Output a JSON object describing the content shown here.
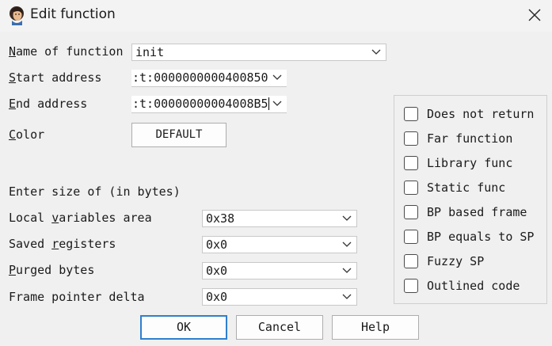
{
  "window": {
    "title": "Edit function",
    "app_icon": "ida-icon",
    "close_icon": "close-icon"
  },
  "form": {
    "name_label_prefix": "N",
    "name_label_rest": "ame of function",
    "name_value": "init",
    "start_label_prefix": "S",
    "start_label_rest": "tart address",
    "start_value": ":t:0000000000400850",
    "end_label_prefix": "E",
    "end_label_rest": "nd address",
    "end_value": ":t:00000000004008B5",
    "color_label_prefix": "C",
    "color_label_rest": "olor",
    "color_button": "DEFAULT",
    "size_heading": "Enter size of (in bytes)",
    "local_vars_label_a": "Local ",
    "local_vars_label_u": "v",
    "local_vars_label_b": "ariables area",
    "local_vars_value": "0x38",
    "saved_regs_label_a": "Saved ",
    "saved_regs_label_u": "r",
    "saved_regs_label_b": "egisters",
    "saved_regs_value": "0x0",
    "purged_label_u": "P",
    "purged_label_b": "urged bytes",
    "purged_value": "0x0",
    "frame_ptr_label": "Frame pointer delta",
    "frame_ptr_value": "0x0"
  },
  "flags": [
    {
      "label": "Does not return",
      "checked": false
    },
    {
      "label": "Far function",
      "checked": false
    },
    {
      "label": "Library func",
      "checked": false
    },
    {
      "label": "Static func",
      "checked": false
    },
    {
      "label": "BP based frame",
      "checked": false
    },
    {
      "label": "BP equals to SP",
      "checked": false
    },
    {
      "label": "Fuzzy SP",
      "checked": false
    },
    {
      "label": "Outlined code",
      "checked": false
    }
  ],
  "buttons": {
    "ok": "OK",
    "cancel": "Cancel",
    "help": "Help"
  },
  "colors": {
    "default_button_border": "#2f7fcf",
    "background": "#f0f0f0"
  }
}
